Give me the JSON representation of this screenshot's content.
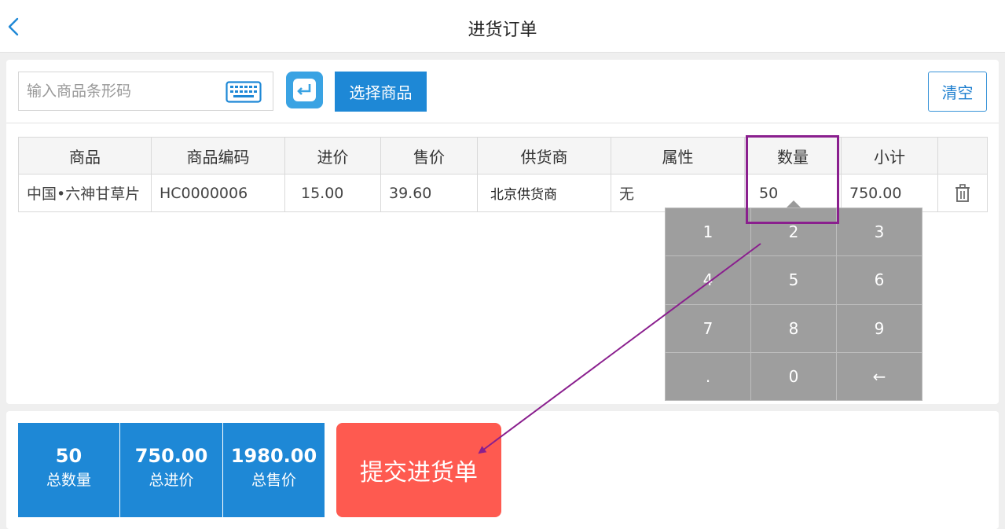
{
  "header": {
    "title": "进货订单"
  },
  "toolbar": {
    "search_placeholder": "输入商品条形码",
    "select_label": "选择商品",
    "clear_label": "清空"
  },
  "table": {
    "columns": [
      "商品",
      "商品编码",
      "进价",
      "售价",
      "供货商",
      "属性",
      "数量",
      "小计"
    ],
    "rows": [
      {
        "product": "中国•六神甘草片",
        "code": "HC0000006",
        "purchase_price": "15.00",
        "sale_price": "39.60",
        "supplier": "北京供货商",
        "attribute": "无",
        "quantity": "50",
        "subtotal": "750.00"
      }
    ]
  },
  "numpad": {
    "keys": [
      "1",
      "2",
      "3",
      "4",
      "5",
      "6",
      "7",
      "8",
      "9",
      ".",
      "0",
      "←"
    ]
  },
  "summary": {
    "total_qty_value": "50",
    "total_qty_label": "总数量",
    "total_cost_value": "750.00",
    "total_cost_label": "总进价",
    "total_sale_value": "1980.00",
    "total_sale_label": "总售价",
    "submit_label": "提交进货单"
  },
  "colors": {
    "primary": "#1e88d6",
    "submit": "#fe5a50",
    "annotation": "#8a1f8e",
    "numpad": "#9e9e9e"
  }
}
